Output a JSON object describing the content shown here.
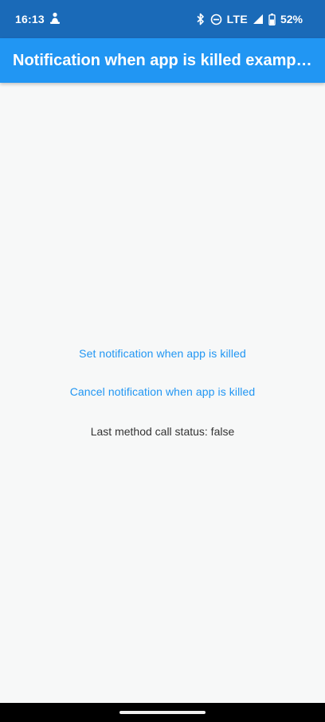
{
  "status_bar": {
    "time": "16:13",
    "left_icon": "notification-person-icon",
    "bluetooth_icon": "bluetooth-icon",
    "dnd_icon": "do-not-disturb-icon",
    "network": "LTE",
    "signal_icon": "cellular-signal-icon",
    "battery_icon": "battery-icon",
    "battery_level": "52%"
  },
  "app_bar": {
    "title": "Notification when app is killed example app"
  },
  "main": {
    "set_button_label": "Set notification when app is killed",
    "cancel_button_label": "Cancel notification when app is killed",
    "status_text": "Last method call status: false"
  },
  "colors": {
    "status_bar": "#1a6ab8",
    "app_bar": "#2196f3",
    "accent": "#2196f3",
    "background": "#f7f8f8"
  }
}
